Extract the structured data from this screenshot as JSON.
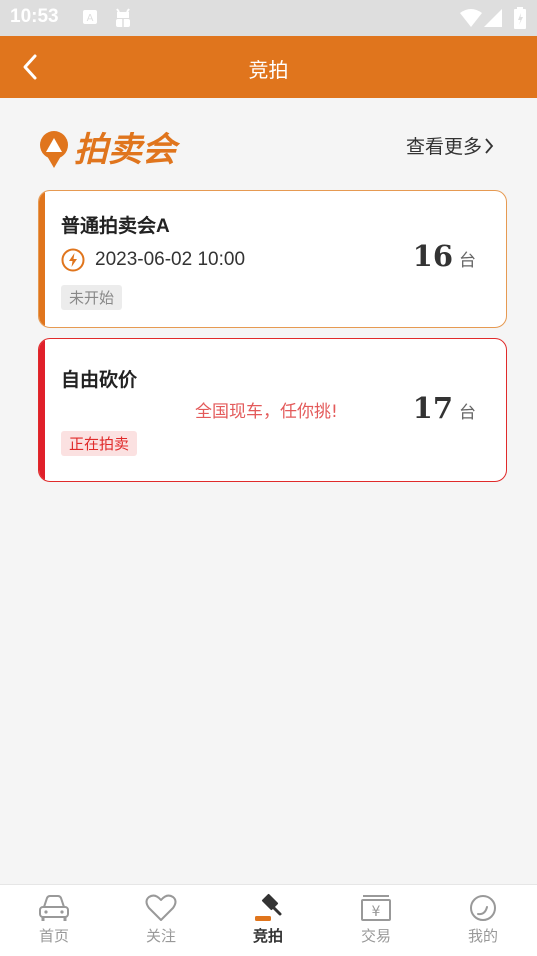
{
  "status_bar": {
    "time": "10:53"
  },
  "app_bar": {
    "title": "竞拍"
  },
  "section": {
    "logo_text": "拍卖会",
    "more_label": "查看更多"
  },
  "auctions": [
    {
      "name": "普通拍卖会A",
      "datetime": "2023-06-02 10:00",
      "count": "16",
      "unit": "台",
      "status": "未开始"
    },
    {
      "name": "自由砍价",
      "slogan": "全国现车，任你挑!",
      "count": "17",
      "unit": "台",
      "status": "正在拍卖"
    }
  ],
  "tabs": [
    {
      "label": "首页",
      "icon": "car-icon"
    },
    {
      "label": "关注",
      "icon": "heart-icon"
    },
    {
      "label": "竞拍",
      "icon": "gavel-icon",
      "active": true
    },
    {
      "label": "交易",
      "icon": "yuan-icon"
    },
    {
      "label": "我的",
      "icon": "profile-icon"
    }
  ],
  "colors": {
    "primary": "#e0751d",
    "red": "#e0202a",
    "background": "#f5f5f5"
  }
}
